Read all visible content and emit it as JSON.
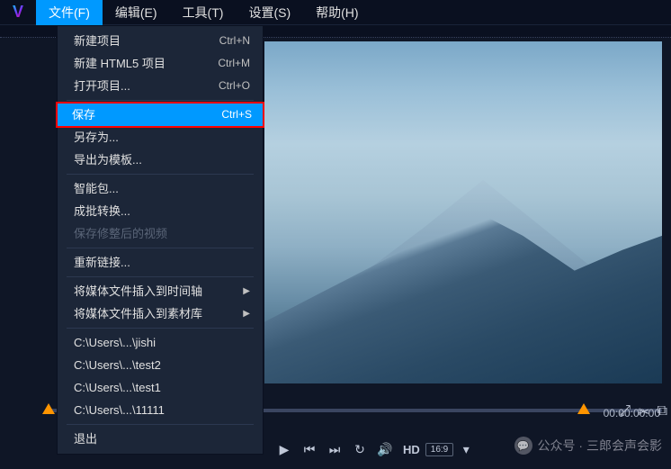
{
  "menubar": {
    "items": [
      {
        "label": "文件(F)",
        "active": true
      },
      {
        "label": "编辑(E)"
      },
      {
        "label": "工具(T)"
      },
      {
        "label": "设置(S)"
      },
      {
        "label": "帮助(H)"
      }
    ]
  },
  "dropdown": {
    "groups": [
      [
        {
          "label": "新建项目",
          "shortcut": "Ctrl+N"
        },
        {
          "label": "新建 HTML5 项目",
          "shortcut": "Ctrl+M"
        },
        {
          "label": "打开项目...",
          "shortcut": "Ctrl+O"
        }
      ],
      [
        {
          "label": "保存",
          "shortcut": "Ctrl+S",
          "highlighted": true
        },
        {
          "label": "另存为..."
        },
        {
          "label": "导出为模板..."
        }
      ],
      [
        {
          "label": "智能包..."
        },
        {
          "label": "成批转换..."
        },
        {
          "label": "保存修整后的视频",
          "disabled": true
        }
      ],
      [
        {
          "label": "重新链接..."
        }
      ],
      [
        {
          "label": "将媒体文件插入到时间轴",
          "submenu": true
        },
        {
          "label": "将媒体文件插入到素材库",
          "submenu": true
        }
      ],
      [
        {
          "label": "C:\\Users\\...\\jishi"
        },
        {
          "label": "C:\\Users\\...\\test2"
        },
        {
          "label": "C:\\Users\\...\\test1"
        },
        {
          "label": "C:\\Users\\...\\11111"
        }
      ],
      [
        {
          "label": "退出"
        }
      ]
    ]
  },
  "controls": {
    "hd": "HD",
    "ratio": "16:9"
  },
  "timestamp": "00:00:00.00",
  "watermark": "公众号 · 三郎会声会影"
}
